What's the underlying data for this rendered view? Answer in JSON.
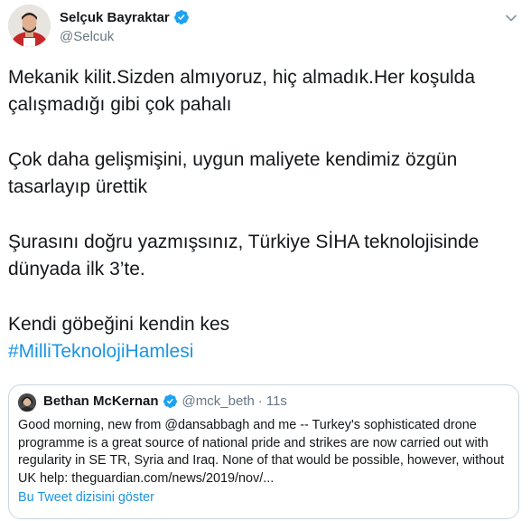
{
  "author": {
    "display_name": "Selçuk Bayraktar",
    "handle": "@Selcuk",
    "verified": true
  },
  "tweet": {
    "paragraphs": [
      "Mekanik kilit.Sizden almıyoruz, hiç almadık.Her koşulda çalışmadığı gibi çok pahalı",
      "Çok daha gelişmişini, uygun maliyete kendimiz özgün tasarlayıp ürettik",
      "Şurasını doğru yazmışsınız, Türkiye SİHA teknolojisinde dünyada ilk 3’te.",
      "Kendi göbeğini kendin kes"
    ],
    "hashtag": "#MilliTeknolojiHamlesi"
  },
  "quoted_tweet": {
    "display_name": "Bethan McKernan",
    "handle": "@mck_beth",
    "separator": "·",
    "time": "11s",
    "verified": true,
    "text": "Good morning, new from @dansabbagh and me -- Turkey's sophisticated drone programme is a great source of national pride and strikes are now carried out with regularity in SE TR, Syria and Iraq. None of that would be possible, however, without UK help: theguardian.com/news/2019/nov/...",
    "thread_link": "Bu Tweet dizisini göster"
  },
  "colors": {
    "link": "#1b95e0",
    "verified": "#1da1f2",
    "secondary_text": "#657786",
    "border": "#ccd6dd"
  },
  "icons": {
    "verified": "verified-badge-icon",
    "more": "chevron-down-icon"
  }
}
